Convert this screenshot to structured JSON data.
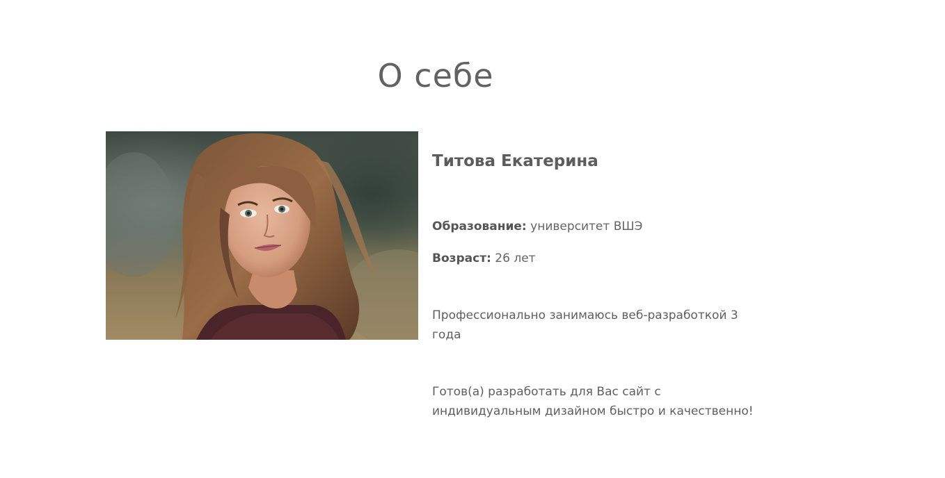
{
  "section": {
    "title": "О себе"
  },
  "profile": {
    "photo_icon": "portrait-photo",
    "name": "Титова Екатерина",
    "education_label": "Образование:",
    "education_value": " университет ВШЭ",
    "age_label": "Возраст:",
    "age_value": " 26 лет",
    "experience": "Профессионально занимаюсь веб-разработкой 3 года",
    "offer_line1": "Готов(а) разработать для Вас сайт с",
    "offer_line2": "индивидуальным дизайном быстро и качественно!"
  },
  "colors": {
    "text": "#5f5f5f",
    "background": "#ffffff"
  }
}
